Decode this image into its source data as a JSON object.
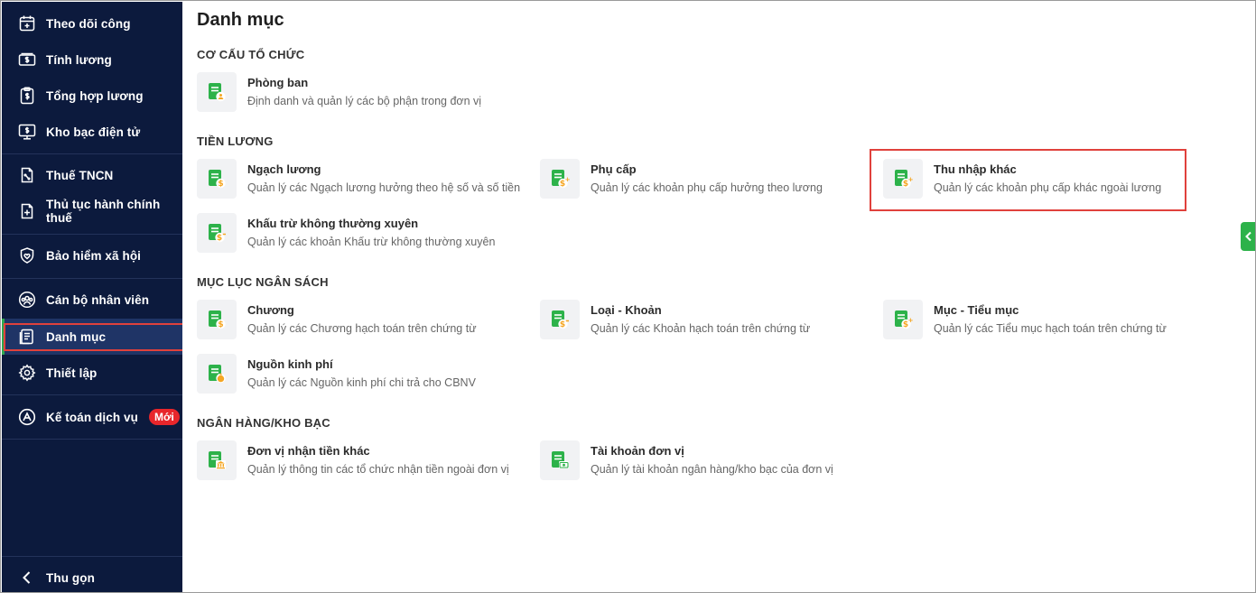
{
  "sidebar": {
    "items": [
      {
        "label": "Theo dõi công",
        "icon": "calendar-plus-icon"
      },
      {
        "label": "Tính lương",
        "icon": "cash-icon"
      },
      {
        "label": "Tổng hợp lương",
        "icon": "clipboard-dollar-icon"
      },
      {
        "label": "Kho bạc điện tử",
        "icon": "monitor-dollar-icon"
      },
      {
        "label": "Thuế TNCN",
        "icon": "tax-document-icon"
      },
      {
        "label": "Thủ tục hành chính thuế",
        "icon": "document-plus-icon"
      },
      {
        "label": "Bảo hiểm xã hội",
        "icon": "shield-heart-icon"
      },
      {
        "label": "Cán bộ nhân viên",
        "icon": "users-circle-icon"
      },
      {
        "label": "Danh mục",
        "icon": "list-document-icon"
      },
      {
        "label": "Thiết lập",
        "icon": "gear-icon"
      },
      {
        "label": "Kế toán dịch vụ",
        "icon": "accounting-service-icon",
        "badge": "Mới"
      }
    ],
    "collapse_label": "Thu gọn",
    "active_item": "Danh mục",
    "colors": {
      "background": "#0c1a3d",
      "highlight_border": "#e0413c",
      "badge": "#e8262b"
    }
  },
  "main": {
    "title": "Danh mục",
    "sections": [
      {
        "title": "CƠ CẤU TỔ CHỨC",
        "cards": [
          {
            "title": "Phòng ban",
            "desc": "Định danh và quản lý các bộ phận trong đơn vị",
            "icon": "department-icon"
          }
        ]
      },
      {
        "title": "TIỀN LƯƠNG",
        "cards": [
          {
            "title": "Ngạch lương",
            "desc": "Quản lý các Ngạch lương hưởng theo hệ số và số tiền",
            "icon": "salary-scale-icon"
          },
          {
            "title": "Phụ cấp",
            "desc": "Quản lý các khoản phụ cấp hưởng theo lương",
            "icon": "allowance-icon"
          },
          {
            "title": "Thu nhập khác",
            "desc": "Quản lý các khoản phụ cấp khác ngoài lương",
            "icon": "other-income-icon"
          },
          {
            "title": "Khấu trừ không thường xuyên",
            "desc": "Quản lý các khoản Khấu trừ không thường xuyên",
            "icon": "deduction-icon"
          }
        ]
      },
      {
        "title": "MỤC LỤC NGÂN SÁCH",
        "cards": [
          {
            "title": "Chương",
            "desc": "Quản lý các Chương hạch toán trên chứng từ",
            "icon": "chapter-icon"
          },
          {
            "title": "Loại - Khoản",
            "desc": "Quản lý các Khoản hạch toán trên chứng từ",
            "icon": "category-icon"
          },
          {
            "title": "Mục - Tiểu mục",
            "desc": "Quản lý các Tiểu mục hạch toán trên chứng từ",
            "icon": "sub-item-icon"
          },
          {
            "title": "Nguồn kinh phí",
            "desc": "Quản lý các Nguồn kinh phí chi trả cho CBNV",
            "icon": "funding-source-icon"
          }
        ]
      },
      {
        "title": "NGÂN HÀNG/KHO BẠC",
        "cards": [
          {
            "title": "Đơn vị nhận tiền khác",
            "desc": "Quản lý thông tin các tổ chức nhận tiền ngoài đơn vị",
            "icon": "bank-recipient-icon"
          },
          {
            "title": "Tài khoản đơn vị",
            "desc": "Quản lý tài khoản ngân hàng/kho bạc của đơn vị",
            "icon": "unit-account-icon"
          }
        ]
      }
    ],
    "highlighted_card": "Thu nhập khác",
    "colors": {
      "icon_green": "#2db24a",
      "icon_accent": "#f5a623",
      "card_icon_bg": "#f1f2f4"
    }
  },
  "side_toggle": {
    "icon": "chevron-left-icon"
  }
}
